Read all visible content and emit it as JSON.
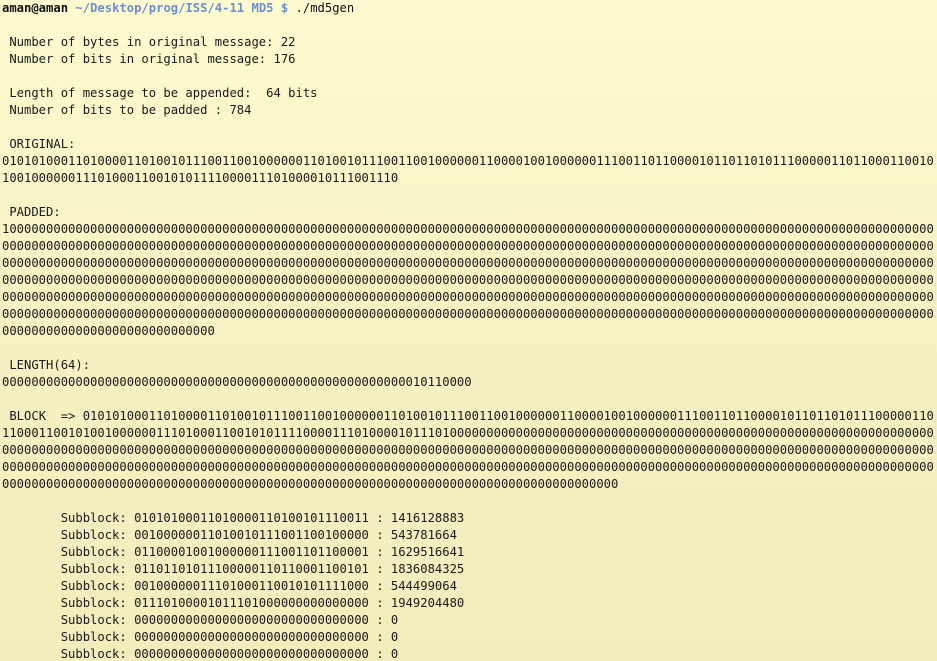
{
  "prompt": {
    "user_host": "aman@aman",
    "path": "~/Desktop/prog/ISS/4-11 MD5 $",
    "command": " ./md5gen"
  },
  "output": {
    "bytes_line": " Number of bytes in original message: 22",
    "bits_line": " Number of bits in original message: 176",
    "append_line": " Length of message to be appended:  64 bits",
    "padded_count_line": " Number of bits to be padded : 784",
    "original_label": " ORIGINAL:",
    "original_bits": "0101010001101000011010010111001100100000011010010111001100100000011000010010000001110011011000010110110101110000011011000110010100100000011101000110010101111000011101000010111001110",
    "padded_label": " PADDED:",
    "padded_bits": "10000000000000000000000000000000000000000000000000000000000000000000000000000000000000000000000000000000000000000000000000000000000000000000000000000000000000000000000000000000000000000000000000000000000000000000000000000000000000000000000000000000000000000000000000000000000000000000000000000000000000000000000000000000000000000000000000000000000000000000000000000000000000000000000000000000000000000000000000000000000000000000000000000000000000000000000000000000000000000000000000000000000000000000000000000000000000000000000000000000000000000000000000000000000000000000000000000000000000000000000000000000000000000000000000000000000000000000000000000000000000000000000000000000000000000000000000000000000000000000000000000000000000000000000000000000000000000000000000000000000000000000000",
    "length_label": " LENGTH(64):",
    "length_bits": "0000000000000000000000000000000000000000000000000000000010110000",
    "block_line": " BLOCK  => 01010100011010000110100101110011001000000110100101110011001000000110000100100000011100110110000101101101011100000110110001100101001000000111010001100101011110000111010000101110100000000000000000000000000000000000000000000000000000000000000000000000000000000000000000000000000000000000000000000000000000000000000000000000000000000000000000000000000000000000000000000000000000000000000000000000000000000000000000000000000000000000000000000000000000000000000000000000000000000000000000000000000000000000000000000000000000000000000000000000000000000000000000000000000000000000000000000",
    "subblocks": [
      "        Subblock: 01010100011010000110100101110011 : 1416128883",
      "        Subblock: 00100000011010010111001100100000 : 543781664",
      "        Subblock: 01100001001000000111001101100001 : 1629516641",
      "        Subblock: 01101101011100000110110001100101 : 1836084325",
      "        Subblock: 00100000011101000110010101111000 : 544499064",
      "        Subblock: 01110100001011101000000000000000 : 1949204480",
      "        Subblock: 00000000000000000000000000000000 : 0",
      "        Subblock: 00000000000000000000000000000000 : 0",
      "        Subblock: 00000000000000000000000000000000 : 0"
    ]
  }
}
